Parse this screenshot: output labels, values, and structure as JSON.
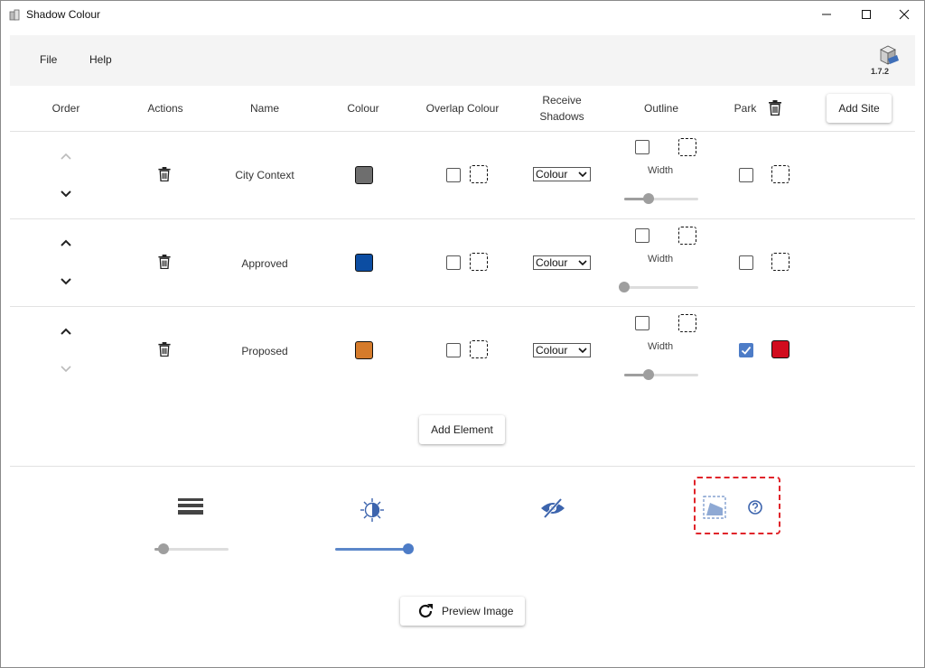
{
  "window": {
    "title": "Shadow Colour"
  },
  "menu": {
    "file": "File",
    "help": "Help",
    "version": "1.7.2"
  },
  "headers": {
    "order": "Order",
    "actions": "Actions",
    "name": "Name",
    "colour": "Colour",
    "overlap_colour": "Overlap Colour",
    "receive_shadows_line1": "Receive",
    "receive_shadows_line2": "Shadows",
    "outline": "Outline",
    "park": "Park",
    "add_site": "Add Site"
  },
  "rows": [
    {
      "name": "City Context",
      "colour": "#6e6e6e",
      "receive": "Colour",
      "width_label": "Width",
      "width_value": 0.35,
      "park_checked": false,
      "park_colour": null,
      "up_enabled": false,
      "down_enabled": true
    },
    {
      "name": "Approved",
      "colour": "#0c4da2",
      "receive": "Colour",
      "width_label": "Width",
      "width_value": 0.0,
      "park_checked": false,
      "park_colour": null,
      "up_enabled": true,
      "down_enabled": true
    },
    {
      "name": "Proposed",
      "colour": "#d57b2b",
      "receive": "Colour",
      "width_label": "Width",
      "width_value": 0.35,
      "park_checked": true,
      "park_colour": "#d10c1e",
      "up_enabled": true,
      "down_enabled": false
    }
  ],
  "add_element": "Add Element",
  "bottom": {
    "layers_slider_value": 0.1,
    "brightness_slider_value": 1.0,
    "preview_label": "Preview Image"
  },
  "colors": {
    "accent": "#4d7cc7",
    "highlight_border": "#e0242a"
  }
}
